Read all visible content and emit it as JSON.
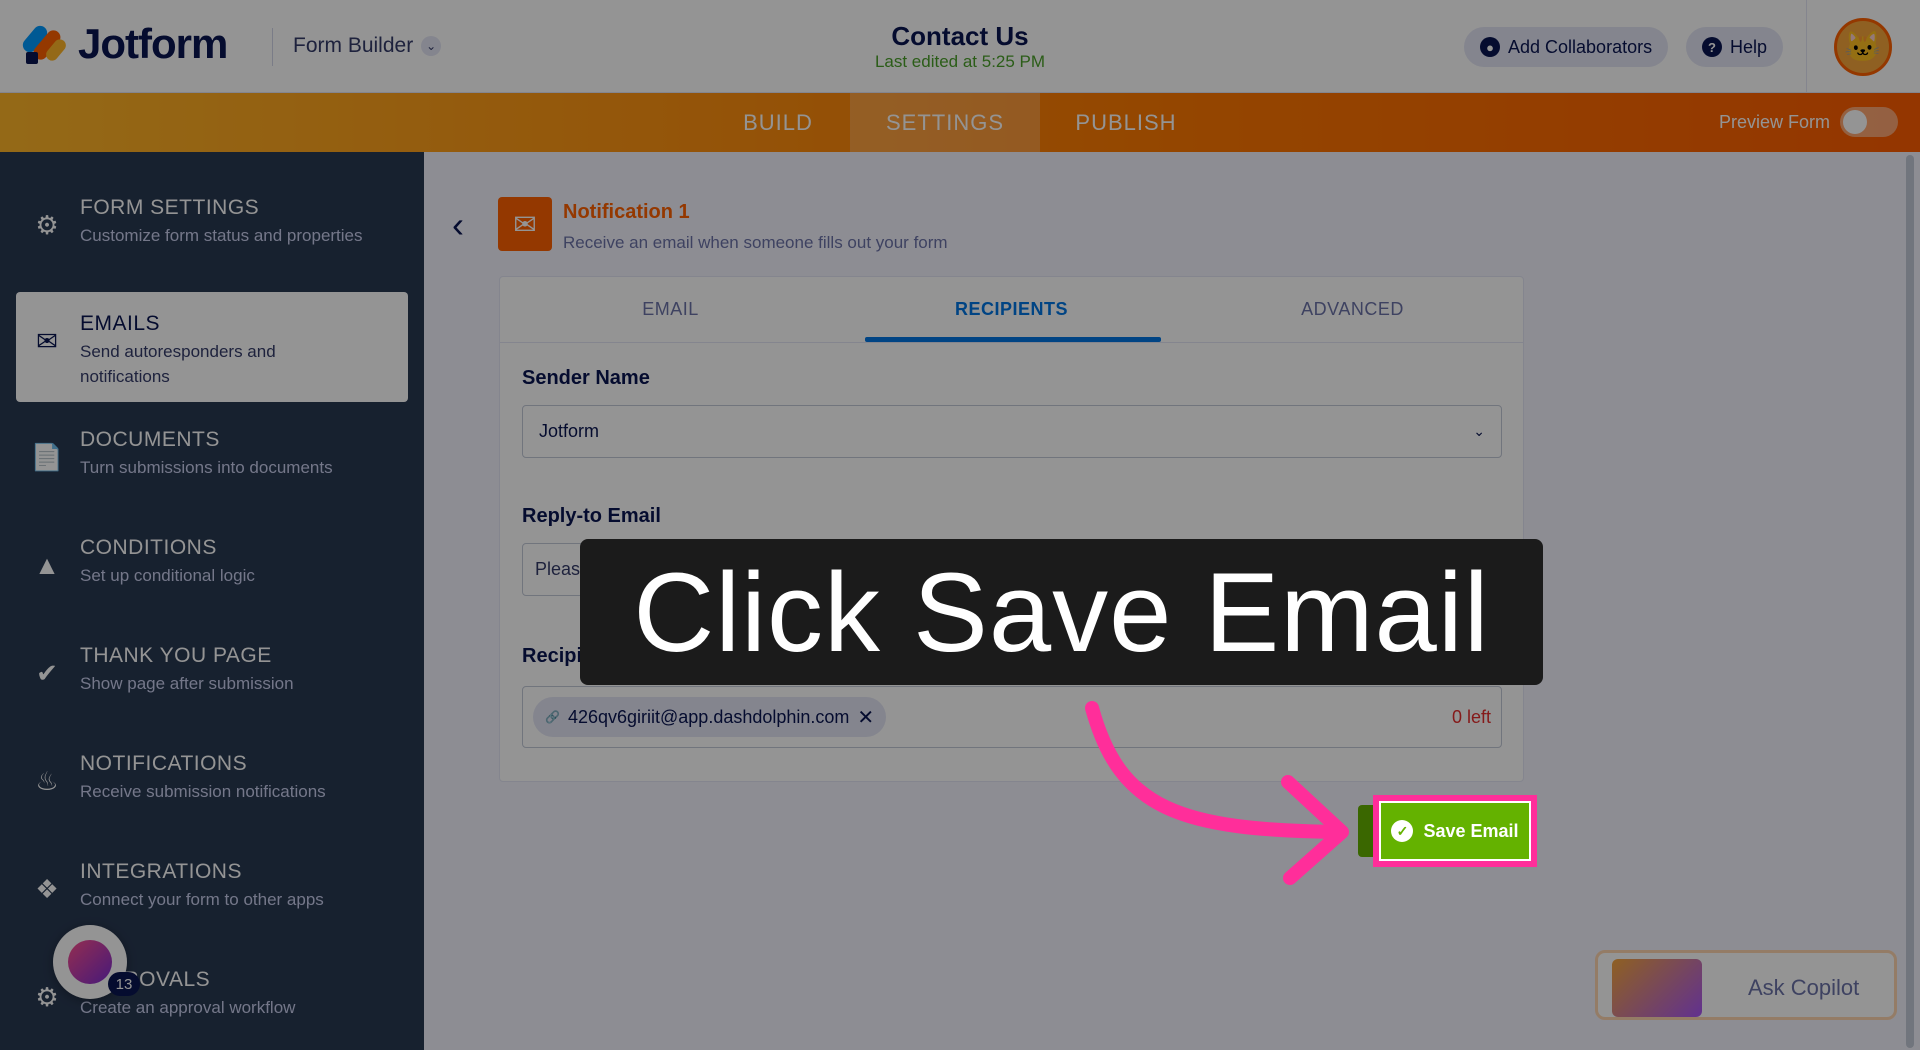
{
  "header": {
    "logo_text": "Jotform",
    "builder_switch": "Form Builder",
    "form_title": "Contact Us",
    "last_edited": "Last edited at 5:25 PM",
    "add_collaborators": "Add Collaborators",
    "help": "Help"
  },
  "tabs": [
    {
      "label": "BUILD"
    },
    {
      "label": "SETTINGS"
    },
    {
      "label": "PUBLISH"
    }
  ],
  "preview_form": "Preview Form",
  "sidebar": {
    "items": [
      {
        "title": "FORM SETTINGS",
        "desc": "Customize form status and properties"
      },
      {
        "title": "EMAILS",
        "desc": "Send autoresponders and notifications"
      },
      {
        "title": "DOCUMENTS",
        "desc": "Turn submissions into documents"
      },
      {
        "title": "CONDITIONS",
        "desc": "Set up conditional logic"
      },
      {
        "title": "THANK YOU PAGE",
        "desc": "Show page after submission"
      },
      {
        "title": "NOTIFICATIONS",
        "desc": "Receive submission notifications"
      },
      {
        "title": "INTEGRATIONS",
        "desc": "Connect your form to other apps"
      },
      {
        "title": "APPROVALS",
        "desc": "Create an approval workflow"
      }
    ],
    "agent_badge": "13"
  },
  "notification": {
    "title": "Notification 1",
    "desc": "Receive an email when someone fills out your form"
  },
  "card": {
    "tabs": [
      {
        "label": "EMAIL"
      },
      {
        "label": "RECIPIENTS"
      },
      {
        "label": "ADVANCED"
      }
    ],
    "sender_name_label": "Sender Name",
    "sender_name_value": "Jotform",
    "reply_to_label": "Reply-to Email",
    "reply_to_value": "Please Se",
    "recipient_label": "Recipient Email *",
    "recipient_chip": "426qv6giriit@app.dashdolphin.com",
    "recipient_left": "0 left"
  },
  "save_button": "Save Email",
  "copilot": "Ask Copilot",
  "overlay": {
    "callout": "Click Save Email"
  },
  "colors": {
    "accent": "#ff6100",
    "sidebar_bg": "#293952",
    "save_green": "#64b200",
    "highlight": "#ff2e9a"
  }
}
